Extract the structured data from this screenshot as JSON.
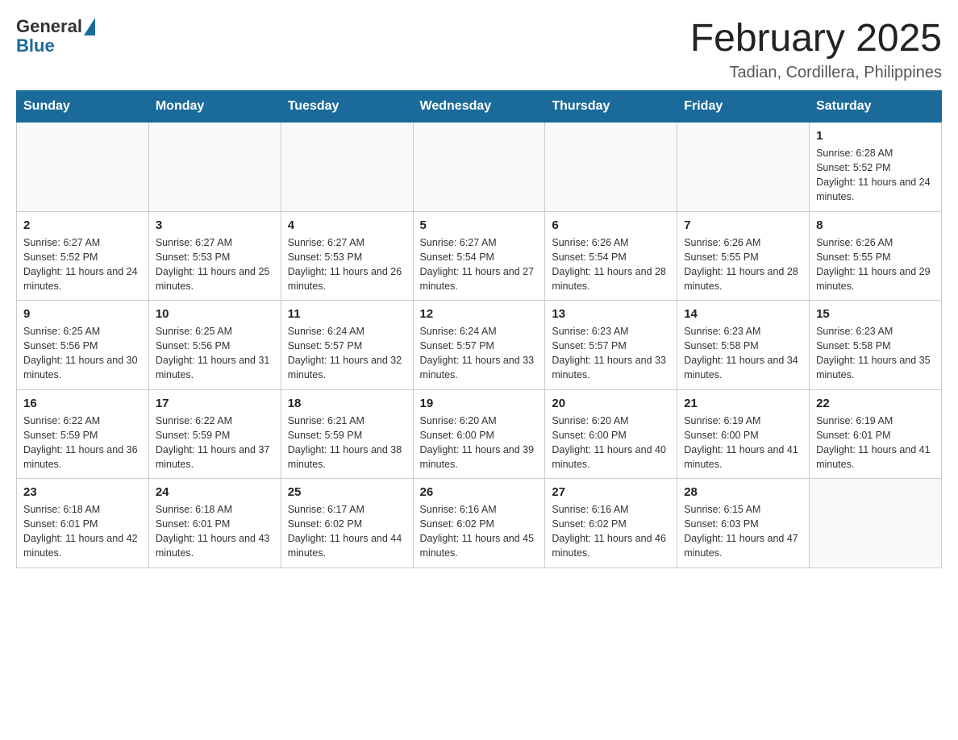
{
  "logo": {
    "general": "General",
    "blue": "Blue"
  },
  "title": "February 2025",
  "subtitle": "Tadian, Cordillera, Philippines",
  "days_of_week": [
    "Sunday",
    "Monday",
    "Tuesday",
    "Wednesday",
    "Thursday",
    "Friday",
    "Saturday"
  ],
  "weeks": [
    [
      {
        "day": "",
        "info": ""
      },
      {
        "day": "",
        "info": ""
      },
      {
        "day": "",
        "info": ""
      },
      {
        "day": "",
        "info": ""
      },
      {
        "day": "",
        "info": ""
      },
      {
        "day": "",
        "info": ""
      },
      {
        "day": "1",
        "info": "Sunrise: 6:28 AM\nSunset: 5:52 PM\nDaylight: 11 hours and 24 minutes."
      }
    ],
    [
      {
        "day": "2",
        "info": "Sunrise: 6:27 AM\nSunset: 5:52 PM\nDaylight: 11 hours and 24 minutes."
      },
      {
        "day": "3",
        "info": "Sunrise: 6:27 AM\nSunset: 5:53 PM\nDaylight: 11 hours and 25 minutes."
      },
      {
        "day": "4",
        "info": "Sunrise: 6:27 AM\nSunset: 5:53 PM\nDaylight: 11 hours and 26 minutes."
      },
      {
        "day": "5",
        "info": "Sunrise: 6:27 AM\nSunset: 5:54 PM\nDaylight: 11 hours and 27 minutes."
      },
      {
        "day": "6",
        "info": "Sunrise: 6:26 AM\nSunset: 5:54 PM\nDaylight: 11 hours and 28 minutes."
      },
      {
        "day": "7",
        "info": "Sunrise: 6:26 AM\nSunset: 5:55 PM\nDaylight: 11 hours and 28 minutes."
      },
      {
        "day": "8",
        "info": "Sunrise: 6:26 AM\nSunset: 5:55 PM\nDaylight: 11 hours and 29 minutes."
      }
    ],
    [
      {
        "day": "9",
        "info": "Sunrise: 6:25 AM\nSunset: 5:56 PM\nDaylight: 11 hours and 30 minutes."
      },
      {
        "day": "10",
        "info": "Sunrise: 6:25 AM\nSunset: 5:56 PM\nDaylight: 11 hours and 31 minutes."
      },
      {
        "day": "11",
        "info": "Sunrise: 6:24 AM\nSunset: 5:57 PM\nDaylight: 11 hours and 32 minutes."
      },
      {
        "day": "12",
        "info": "Sunrise: 6:24 AM\nSunset: 5:57 PM\nDaylight: 11 hours and 33 minutes."
      },
      {
        "day": "13",
        "info": "Sunrise: 6:23 AM\nSunset: 5:57 PM\nDaylight: 11 hours and 33 minutes."
      },
      {
        "day": "14",
        "info": "Sunrise: 6:23 AM\nSunset: 5:58 PM\nDaylight: 11 hours and 34 minutes."
      },
      {
        "day": "15",
        "info": "Sunrise: 6:23 AM\nSunset: 5:58 PM\nDaylight: 11 hours and 35 minutes."
      }
    ],
    [
      {
        "day": "16",
        "info": "Sunrise: 6:22 AM\nSunset: 5:59 PM\nDaylight: 11 hours and 36 minutes."
      },
      {
        "day": "17",
        "info": "Sunrise: 6:22 AM\nSunset: 5:59 PM\nDaylight: 11 hours and 37 minutes."
      },
      {
        "day": "18",
        "info": "Sunrise: 6:21 AM\nSunset: 5:59 PM\nDaylight: 11 hours and 38 minutes."
      },
      {
        "day": "19",
        "info": "Sunrise: 6:20 AM\nSunset: 6:00 PM\nDaylight: 11 hours and 39 minutes."
      },
      {
        "day": "20",
        "info": "Sunrise: 6:20 AM\nSunset: 6:00 PM\nDaylight: 11 hours and 40 minutes."
      },
      {
        "day": "21",
        "info": "Sunrise: 6:19 AM\nSunset: 6:00 PM\nDaylight: 11 hours and 41 minutes."
      },
      {
        "day": "22",
        "info": "Sunrise: 6:19 AM\nSunset: 6:01 PM\nDaylight: 11 hours and 41 minutes."
      }
    ],
    [
      {
        "day": "23",
        "info": "Sunrise: 6:18 AM\nSunset: 6:01 PM\nDaylight: 11 hours and 42 minutes."
      },
      {
        "day": "24",
        "info": "Sunrise: 6:18 AM\nSunset: 6:01 PM\nDaylight: 11 hours and 43 minutes."
      },
      {
        "day": "25",
        "info": "Sunrise: 6:17 AM\nSunset: 6:02 PM\nDaylight: 11 hours and 44 minutes."
      },
      {
        "day": "26",
        "info": "Sunrise: 6:16 AM\nSunset: 6:02 PM\nDaylight: 11 hours and 45 minutes."
      },
      {
        "day": "27",
        "info": "Sunrise: 6:16 AM\nSunset: 6:02 PM\nDaylight: 11 hours and 46 minutes."
      },
      {
        "day": "28",
        "info": "Sunrise: 6:15 AM\nSunset: 6:03 PM\nDaylight: 11 hours and 47 minutes."
      },
      {
        "day": "",
        "info": ""
      }
    ]
  ]
}
